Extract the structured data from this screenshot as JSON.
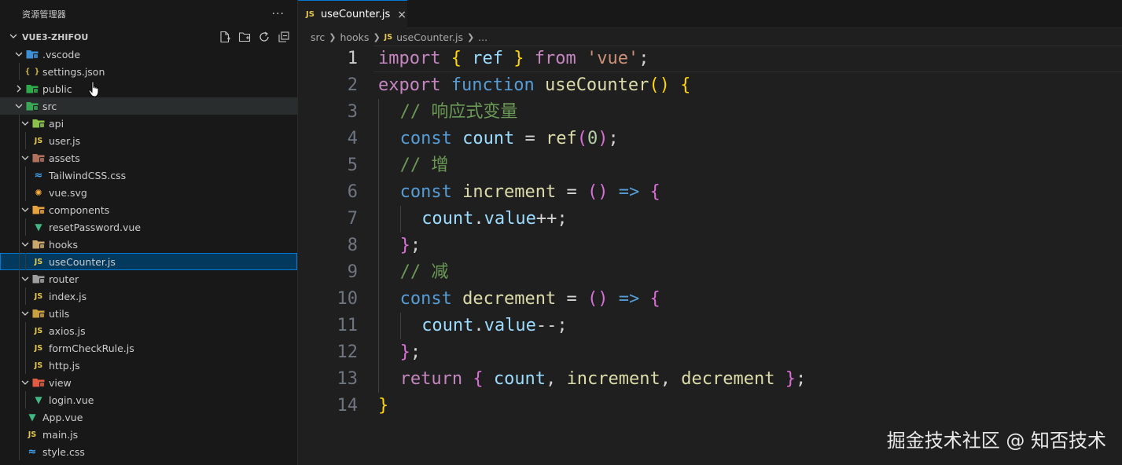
{
  "sidebar": {
    "title": "资源管理器",
    "more": "···",
    "project": "VUE3-ZHIFOU",
    "actions": [
      "new-file-icon",
      "new-folder-icon",
      "refresh-icon",
      "collapse-all-icon"
    ],
    "tree": [
      {
        "label": ".vscode",
        "type": "folder",
        "depth": 1,
        "open": true,
        "icon": "vscode-folder-icon",
        "color": "#3d8fd6"
      },
      {
        "label": "settings.json",
        "type": "file",
        "depth": 2,
        "icon": "json-file-icon",
        "glyph": "{ }"
      },
      {
        "label": "public",
        "type": "folder",
        "depth": 1,
        "open": false,
        "icon": "public-folder-icon",
        "color": "#2faa4a"
      },
      {
        "label": "src",
        "type": "folder",
        "depth": 1,
        "open": true,
        "icon": "src-folder-icon",
        "color": "#3aa756",
        "hl": true
      },
      {
        "label": "api",
        "type": "folder",
        "depth": 2,
        "open": true,
        "icon": "api-folder-icon",
        "color": "#8bc34a"
      },
      {
        "label": "user.js",
        "type": "file",
        "depth": 3,
        "icon": "js-file-icon",
        "glyph": "JS"
      },
      {
        "label": "assets",
        "type": "folder",
        "depth": 2,
        "open": true,
        "icon": "assets-folder-icon",
        "color": "#b0705c"
      },
      {
        "label": "TailwindCSS.css",
        "type": "file",
        "depth": 3,
        "icon": "css-file-icon",
        "glyph": "≈"
      },
      {
        "label": "vue.svg",
        "type": "file",
        "depth": 3,
        "icon": "svg-file-icon",
        "glyph": "✺"
      },
      {
        "label": "components",
        "type": "folder",
        "depth": 2,
        "open": true,
        "icon": "components-folder-icon",
        "color": "#e6a23c"
      },
      {
        "label": "resetPassword.vue",
        "type": "file",
        "depth": 3,
        "icon": "vue-file-icon",
        "glyph": "▼"
      },
      {
        "label": "hooks",
        "type": "folder",
        "depth": 2,
        "open": true,
        "icon": "hooks-folder-icon",
        "color": "#c9a66b"
      },
      {
        "label": "useCounter.js",
        "type": "file",
        "depth": 3,
        "icon": "js-file-icon",
        "glyph": "JS",
        "sel": true
      },
      {
        "label": "router",
        "type": "folder",
        "depth": 2,
        "open": true,
        "icon": "router-folder-icon",
        "color": "#9e9e9e"
      },
      {
        "label": "index.js",
        "type": "file",
        "depth": 3,
        "icon": "js-file-icon",
        "glyph": "JS"
      },
      {
        "label": "utils",
        "type": "folder",
        "depth": 2,
        "open": true,
        "icon": "utils-folder-icon",
        "color": "#c8a040"
      },
      {
        "label": "axios.js",
        "type": "file",
        "depth": 3,
        "icon": "js-file-icon",
        "glyph": "JS"
      },
      {
        "label": "formCheckRule.js",
        "type": "file",
        "depth": 3,
        "icon": "js-file-icon",
        "glyph": "JS"
      },
      {
        "label": "http.js",
        "type": "file",
        "depth": 3,
        "icon": "js-file-icon",
        "glyph": "JS"
      },
      {
        "label": "view",
        "type": "folder",
        "depth": 2,
        "open": true,
        "icon": "view-folder-icon",
        "color": "#e05d44"
      },
      {
        "label": "login.vue",
        "type": "file",
        "depth": 3,
        "icon": "vue-file-icon",
        "glyph": "▼"
      },
      {
        "label": "App.vue",
        "type": "file",
        "depth": 2,
        "icon": "vue-file-icon",
        "glyph": "▼"
      },
      {
        "label": "main.js",
        "type": "file",
        "depth": 2,
        "icon": "js-file-icon",
        "glyph": "JS"
      },
      {
        "label": "style.css",
        "type": "file",
        "depth": 2,
        "icon": "css-file-icon",
        "glyph": "≈"
      }
    ]
  },
  "editor": {
    "tab": {
      "label": "useCounter.js",
      "icon": "JS",
      "close": "×"
    },
    "breadcrumb": [
      "src",
      "hooks",
      "useCounter.js",
      "..."
    ],
    "breadcrumb_icon": "JS",
    "current_line": 1,
    "colors": {
      "keyword_control": "#c586c0",
      "keyword": "#569cd6",
      "function": "#dcdcaa",
      "variable": "#9cdcfe",
      "string": "#ce9178",
      "number": "#b5cea8",
      "comment": "#6a9955",
      "punct": "#d4d4d4",
      "bracket1": "#ffd700",
      "bracket2": "#da70d6",
      "bracket3": "#179fff",
      "arrow": "#569cd6"
    },
    "lines": [
      {
        "n": "1",
        "indent": 0,
        "tokens": [
          [
            "import",
            "keyword_control"
          ],
          [
            " ",
            "punct"
          ],
          [
            "{",
            "bracket1"
          ],
          [
            " ref ",
            "variable"
          ],
          [
            "}",
            "bracket1"
          ],
          [
            " from ",
            "keyword_control"
          ],
          [
            "'vue'",
            "string"
          ],
          [
            ";",
            "punct"
          ]
        ]
      },
      {
        "n": "2",
        "indent": 0,
        "tokens": [
          [
            "export",
            "keyword_control"
          ],
          [
            " ",
            "punct"
          ],
          [
            "function",
            "keyword"
          ],
          [
            " ",
            "punct"
          ],
          [
            "useCounter",
            "function"
          ],
          [
            "()",
            "bracket1"
          ],
          [
            " ",
            "punct"
          ],
          [
            "{",
            "bracket1"
          ]
        ]
      },
      {
        "n": "3",
        "indent": 1,
        "tokens": [
          [
            "// 响应式变量",
            "comment"
          ]
        ]
      },
      {
        "n": "4",
        "indent": 1,
        "tokens": [
          [
            "const",
            "keyword"
          ],
          [
            " count ",
            "variable"
          ],
          [
            "= ",
            "punct"
          ],
          [
            "ref",
            "function"
          ],
          [
            "(",
            "bracket2"
          ],
          [
            "0",
            "number"
          ],
          [
            ")",
            "bracket2"
          ],
          [
            ";",
            "punct"
          ]
        ]
      },
      {
        "n": "5",
        "indent": 1,
        "tokens": [
          [
            "// 增",
            "comment"
          ]
        ]
      },
      {
        "n": "6",
        "indent": 1,
        "tokens": [
          [
            "const",
            "keyword"
          ],
          [
            " increment ",
            "function"
          ],
          [
            "= ",
            "punct"
          ],
          [
            "()",
            "bracket2"
          ],
          [
            " => ",
            "arrow"
          ],
          [
            "{",
            "bracket2"
          ]
        ]
      },
      {
        "n": "7",
        "indent": 2,
        "tokens": [
          [
            "count",
            "variable"
          ],
          [
            ".",
            "punct"
          ],
          [
            "value",
            "variable"
          ],
          [
            "++;",
            "punct"
          ]
        ]
      },
      {
        "n": "8",
        "indent": 1,
        "tokens": [
          [
            "}",
            "bracket2"
          ],
          [
            ";",
            "punct"
          ]
        ]
      },
      {
        "n": "9",
        "indent": 1,
        "tokens": [
          [
            "// 减",
            "comment"
          ]
        ]
      },
      {
        "n": "10",
        "indent": 1,
        "tokens": [
          [
            "const",
            "keyword"
          ],
          [
            " decrement ",
            "function"
          ],
          [
            "= ",
            "punct"
          ],
          [
            "()",
            "bracket2"
          ],
          [
            " => ",
            "arrow"
          ],
          [
            "{",
            "bracket2"
          ]
        ]
      },
      {
        "n": "11",
        "indent": 2,
        "tokens": [
          [
            "count",
            "variable"
          ],
          [
            ".",
            "punct"
          ],
          [
            "value",
            "variable"
          ],
          [
            "--;",
            "punct"
          ]
        ]
      },
      {
        "n": "12",
        "indent": 1,
        "tokens": [
          [
            "}",
            "bracket2"
          ],
          [
            ";",
            "punct"
          ]
        ]
      },
      {
        "n": "13",
        "indent": 1,
        "tokens": [
          [
            "return",
            "keyword_control"
          ],
          [
            " ",
            "punct"
          ],
          [
            "{",
            "bracket2"
          ],
          [
            " count",
            "variable"
          ],
          [
            ", ",
            "punct"
          ],
          [
            "increment",
            "function"
          ],
          [
            ", ",
            "punct"
          ],
          [
            "decrement",
            "function"
          ],
          [
            " ",
            "punct"
          ],
          [
            "}",
            "bracket2"
          ],
          [
            ";",
            "punct"
          ]
        ]
      },
      {
        "n": "14",
        "indent": 0,
        "tokens": [
          [
            "}",
            "bracket1"
          ]
        ]
      }
    ]
  },
  "watermark": "掘金技术社区 @ 知否技术"
}
